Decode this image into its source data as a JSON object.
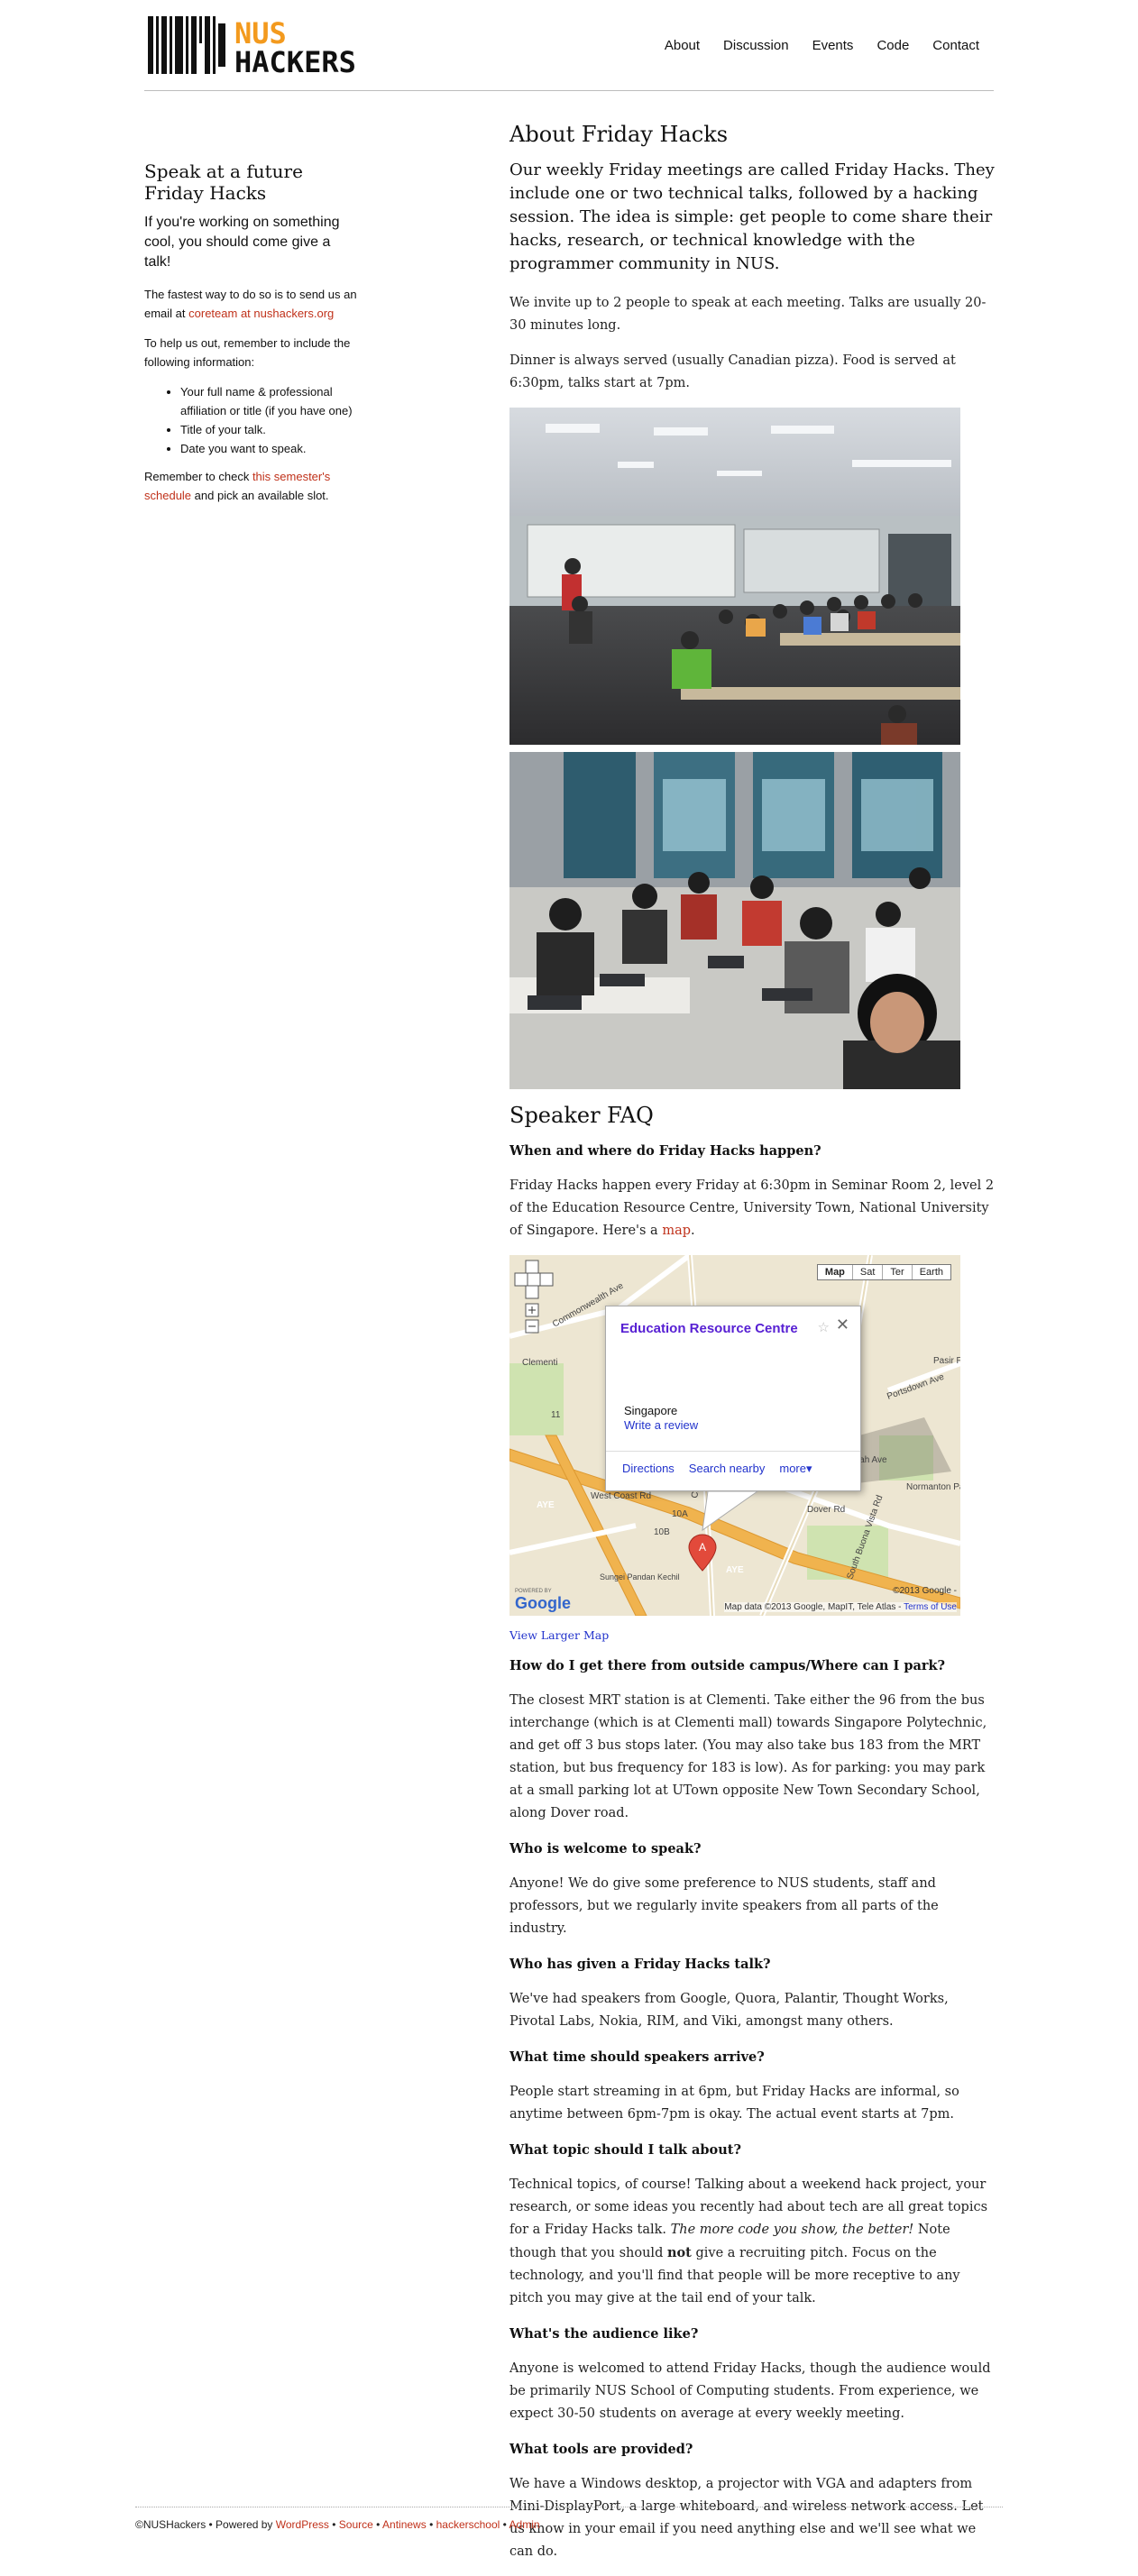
{
  "header": {
    "logo_top": "NUS",
    "logo_bottom": "HACKERS",
    "nav": [
      "About",
      "Discussion",
      "Events",
      "Code",
      "Contact"
    ]
  },
  "sidebar": {
    "title": "Speak at a future Friday Hacks",
    "lead": "If you're working on something cool, you should come give a talk!",
    "p1_before": "The fastest way to do so is to send us an email at ",
    "email": "coreteam at nushackers.org",
    "p2": "To help us out, remember to include the following information:",
    "items": [
      "Your full name & professional affiliation or title (if you have one)",
      "Title of your talk.",
      "Date you want to speak."
    ],
    "p3_before": "Remember to check ",
    "schedule_link": "this semester's schedule",
    "p3_after": " and pick an available slot."
  },
  "main": {
    "title": "About Friday Hacks",
    "intro": "Our weekly Friday meetings are called Friday Hacks. They include one or two technical talks, followed by a hacking session. The idea is simple: get people to come share their hacks, research, or technical knowledge with the programmer community in NUS.",
    "p1": "We invite up to 2 people to speak at each meeting. Talks are usually 20-30 minutes long.",
    "p2": "Dinner is always served (usually Canadian pizza). Food is served at 6:30pm, talks start at 7pm.",
    "faq_title": "Speaker FAQ",
    "q1": "When and where do Friday Hacks happen?",
    "a1_before": "Friday Hacks happen every Friday at 6:30pm in Seminar Room 2, level 2 of the Education Resource Centre, University Town, National University of Singapore. Here's a ",
    "a1_link": "map",
    "a1_after": ".",
    "view_larger": "View Larger Map",
    "faq": [
      {
        "q": "How do I get there from outside campus/Where can I park?",
        "a": "The closest MRT station is at Clementi. Take either the 96 from the bus interchange (which is at Clementi mall) towards Singapore Polytechnic, and get off 3 bus stops later. (You may also take bus 183 from the MRT station, but bus frequency for 183 is low). As for parking: you may park at a small parking lot at UTown opposite New Town Secondary School, along Dover road."
      },
      {
        "q": "Who is welcome to speak?",
        "a": "Anyone! We do give some preference to NUS students, staff and professors, but we regularly invite speakers from all parts of the industry."
      },
      {
        "q": "Who has given a Friday Hacks talk?",
        "a": "We've had speakers from Google, Quora, Palantir, Thought Works, Pivotal Labs, Nokia, RIM, and Viki, amongst many others."
      },
      {
        "q": "What time should speakers arrive?",
        "a": "People start streaming in at 6pm, but Friday Hacks are informal, so anytime between 6pm-7pm is okay. The actual event starts at 7pm."
      }
    ],
    "topic_q": "What topic should I talk about?",
    "topic_a1": "Technical topics, of course! Talking about a weekend hack project, your research, or some ideas you recently had about tech are all great topics for a Friday Hacks talk. ",
    "topic_em": "The more code you show, the better!",
    "topic_a2": " Note though that you should ",
    "topic_strong": "not",
    "topic_a3": " give a recruiting pitch. Focus on the technology, and you'll find that people will be more receptive to any pitch you may give at the tail end of your talk.",
    "faq2": [
      {
        "q": "What's the audience like?",
        "a": "Anyone is welcomed to attend Friday Hacks, though the audience would be primarily NUS School of Computing students. From experience, we expect 30-50 students on average at every weekly meeting."
      },
      {
        "q": "What tools are provided?",
        "a": "We have a Windows desktop, a projector with VGA and adapters from Mini-DisplayPort, a large whiteboard, and wireless network access. Let us know in your email if you need anything else and we'll see what we can do."
      }
    ]
  },
  "map": {
    "types": [
      "Map",
      "Sat",
      "Ter",
      "Earth"
    ],
    "popup_title": "Education Resource Centre",
    "popup_address": "Singapore",
    "popup_review": "Write a review",
    "popup_actions": [
      "Directions",
      "Search nearby",
      "more▾"
    ],
    "labels": [
      "Clementi",
      "AYE",
      "AYE",
      "West Coast Rd",
      "Dover Rd",
      "Clementi Rd",
      "Commonwealth Ave",
      "Sungei Pandan Kechil",
      "Ayer Rajah Ave",
      "South Buona Vista Rd",
      "Portsdown Ave",
      "Normanton Park",
      "Pasir Panjang Rd",
      "10A",
      "10B",
      "11",
      "A"
    ],
    "copyright": "©2013 Google -",
    "mapdata": "Map data ©2013 Google, MapIT, Tele Atlas - ",
    "terms": "Terms of Use",
    "powered": "POWERED BY",
    "google": "Google"
  },
  "footer": {
    "copy": "©NUSHackers • Powered by ",
    "links": [
      "WordPress",
      "Source",
      "Antinews",
      "hackerschool",
      "Admin"
    ],
    "sep": " • "
  }
}
